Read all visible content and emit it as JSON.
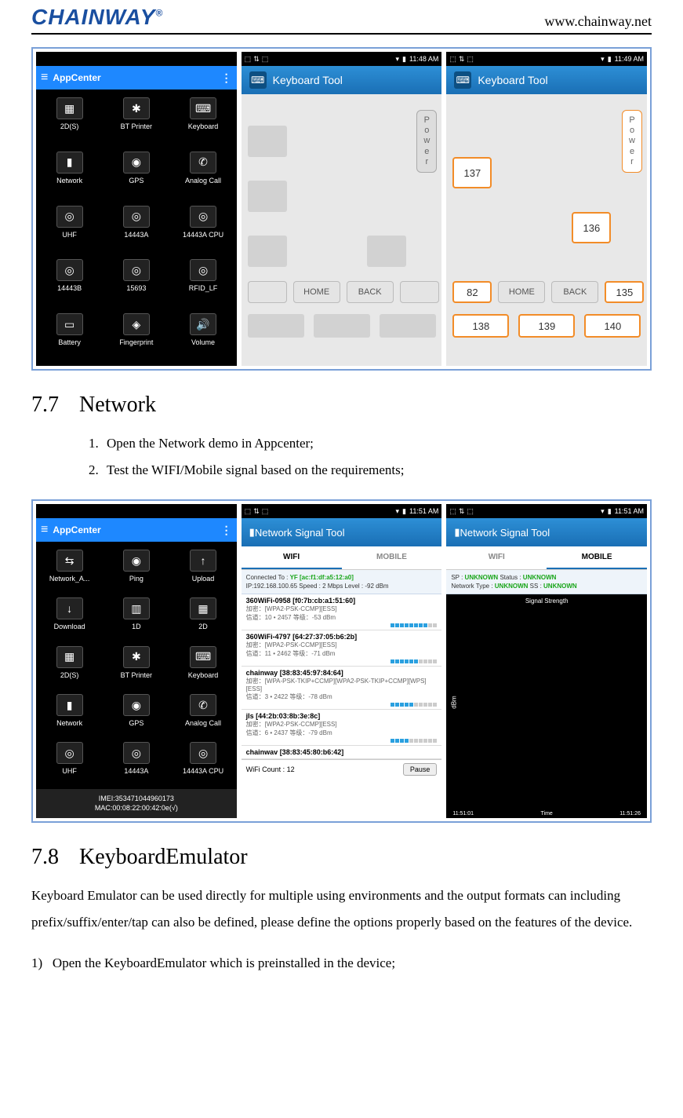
{
  "header": {
    "logo_text": "CHAINWAY",
    "logo_reg": "®",
    "site_url": "www.chainway.net"
  },
  "row1": {
    "appcenter": {
      "title": "AppCenter",
      "items": [
        {
          "label": "2D(S)"
        },
        {
          "label": "BT Printer"
        },
        {
          "label": "Keyboard"
        },
        {
          "label": "Network"
        },
        {
          "label": "GPS"
        },
        {
          "label": "Analog Call"
        },
        {
          "label": "UHF"
        },
        {
          "label": "14443A"
        },
        {
          "label": "14443A CPU"
        },
        {
          "label": "14443B"
        },
        {
          "label": "15693"
        },
        {
          "label": "RFID_LF"
        },
        {
          "label": "Battery"
        },
        {
          "label": "Fingerprint"
        },
        {
          "label": "Volume"
        }
      ]
    },
    "kb1": {
      "time": "11:48 AM",
      "title": "Keyboard Tool",
      "power": "Power",
      "home": "HOME",
      "back": "BACK"
    },
    "kb2": {
      "time": "11:49 AM",
      "title": "Keyboard Tool",
      "power": "Power",
      "home": "HOME",
      "back": "BACK",
      "v137": "137",
      "v136": "136",
      "v82": "82",
      "v135": "135",
      "v138": "138",
      "v139": "139",
      "v140": "140"
    }
  },
  "sec77": {
    "num": "7.7",
    "title": "Network",
    "steps": [
      "Open the Network demo in Appcenter;",
      "Test the WIFI/Mobile signal based on the requirements;"
    ]
  },
  "row2": {
    "appcenter": {
      "title": "AppCenter",
      "items": [
        {
          "label": "Network_A..."
        },
        {
          "label": "Ping"
        },
        {
          "label": "Upload"
        },
        {
          "label": "Download"
        },
        {
          "label": "1D"
        },
        {
          "label": "2D"
        },
        {
          "label": "2D(S)"
        },
        {
          "label": "BT Printer"
        },
        {
          "label": "Keyboard"
        },
        {
          "label": "Network"
        },
        {
          "label": "GPS"
        },
        {
          "label": "Analog Call"
        },
        {
          "label": "UHF"
        },
        {
          "label": "14443A"
        },
        {
          "label": "14443A CPU"
        }
      ],
      "imei_line1": "IMEI:353471044960173",
      "imei_line2": "MAC:00:08:22:00:42:0e(√)"
    },
    "wifi": {
      "time": "11:51 AM",
      "title": "Network Signal Tool",
      "tab_wifi": "WIFI",
      "tab_mobile": "MOBILE",
      "conn_label": "Connected To : ",
      "conn_name": "YF [ac:f1:df:a5:12:a0]",
      "ip": "IP:192.168.100.65  Speed :  2 Mbps  Level : -92 dBm",
      "list": [
        {
          "name": "360WiFi-0958 [f0:7b:cb:a1:51:60]",
          "meta1": "加密：[WPA2-PSK-CCMP][ESS]",
          "meta2": "信道：10 • 2457  等级：-53 dBm"
        },
        {
          "name": "360WiFi-4797 [64:27:37:05:b6:2b]",
          "meta1": "加密：[WPA2-PSK-CCMP][ESS]",
          "meta2": "信道：11 • 2462  等级：-71 dBm"
        },
        {
          "name": "chainway [38:83:45:97:84:64]",
          "meta1": "加密：[WPA-PSK-TKIP+CCMP][WPA2-PSK-TKIP+CCMP][WPS][ESS]",
          "meta2": "信道：3 • 2422  等级：-78 dBm"
        },
        {
          "name": "jls [44:2b:03:8b:3e:8c]",
          "meta1": "加密：[WPA2-PSK-CCMP][ESS]",
          "meta2": "信道：6 • 2437  等级：-79 dBm"
        },
        {
          "name": "chainwav [38:83:45:80:b6:42]",
          "meta1": "",
          "meta2": ""
        }
      ],
      "count": "WiFi Count :  12",
      "pause": "Pause"
    },
    "mobile": {
      "time": "11:51 AM",
      "title": "Network Signal Tool",
      "tab_wifi": "WIFI",
      "tab_mobile": "MOBILE",
      "line1_a": "SP : ",
      "line1_b": "UNKNOWN",
      "line1_c": "  Status :  ",
      "line1_d": "UNKNOWN",
      "line2_a": "Network Type : ",
      "line2_b": "UNKNOWN",
      "line2_c": "  SS :  ",
      "line2_d": "UNKNOWN",
      "chart_title": "Signal Strength",
      "ylabel": "dBm",
      "x1": "11:51:01",
      "x2": "Time",
      "x3": "11:51:26"
    }
  },
  "sec78": {
    "num": "7.8",
    "title": "KeyboardEmulator",
    "para": "Keyboard Emulator can be used directly for multiple using environments and the output formats can including prefix/suffix/enter/tap can also be defined, please define the options properly based on the features of the device.",
    "step1_num": "1",
    "step1": "Open the KeyboardEmulator which is preinstalled in the device;"
  }
}
